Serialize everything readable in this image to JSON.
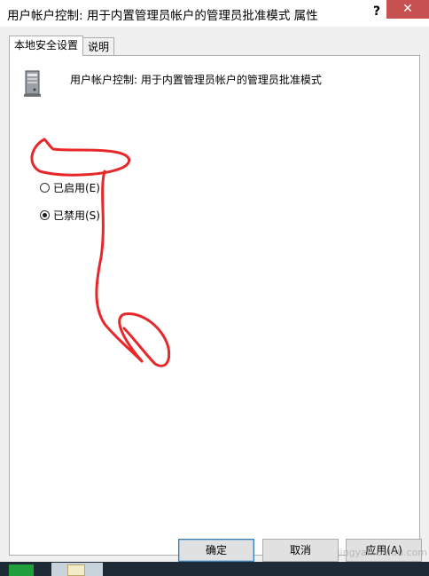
{
  "window": {
    "title": "用户帐户控制: 用于内置管理员帐户的管理员批准模式 属性",
    "help_label": "?",
    "close_label": "✕"
  },
  "tabs": [
    {
      "label": "本地安全设置",
      "active": true
    },
    {
      "label": "说明",
      "active": false
    }
  ],
  "policy": {
    "icon": "server-policy-icon",
    "name": "用户帐户控制: 用于内置管理员帐户的管理员批准模式"
  },
  "options": [
    {
      "label": "已启用(E)",
      "checked": false
    },
    {
      "label": "已禁用(S)",
      "checked": true
    }
  ],
  "buttons": {
    "ok": "确定",
    "cancel": "取消",
    "apply": "应用(A)"
  },
  "watermark": {
    "text": "jingyan.baidu.com"
  },
  "colors": {
    "annotation": "#e8272a",
    "close": "#c75050",
    "default_button_border": "#3c7fb1"
  }
}
